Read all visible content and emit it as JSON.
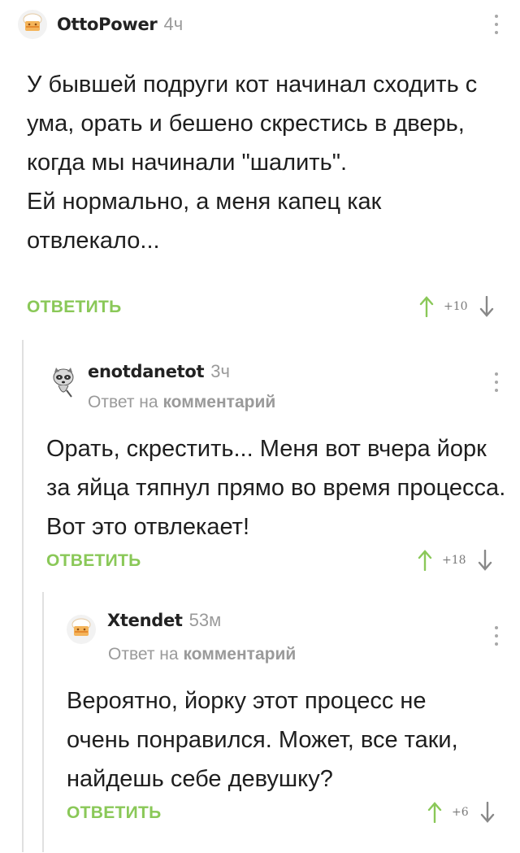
{
  "comments": [
    {
      "username": "OttoPower",
      "time": "4ч",
      "text": "У бывшей подруги кот начинал сходить с ума, орать и бешено скрестись в дверь, когда мы начинали \"шалить\".\nЕй нормально, а меня капец как отвлекало...",
      "reply_label": "ОТВЕТИТЬ",
      "rating": "+10"
    },
    {
      "username": "enotdanetot",
      "time": "3ч",
      "reply_to_prefix": "Ответ на",
      "reply_to_link": "комментарий",
      "text": "Орать, скрестить... Меня вот вчера йорк за яйца тяпнул прямо во время процесса. Вот это отвлекает!",
      "reply_label": "ОТВЕТИТЬ",
      "rating": "+18"
    },
    {
      "username": "Xtendet",
      "time": "53м",
      "reply_to_prefix": "Ответ на",
      "reply_to_link": "комментарий",
      "text": "Вероятно, йорку этот процесс не очень понравился. Может, все таки, найдешь себе девушку?",
      "reply_label": "ОТВЕТИТЬ",
      "rating": "+6"
    }
  ],
  "colors": {
    "accent": "#8ac858",
    "muted": "#9a9a9a",
    "thread": "#e0e0e0"
  },
  "icons": {
    "avatar_default": "chef-hat-avatar-icon",
    "avatar_raccoon": "raccoon-avatar-icon",
    "menu": "more-vertical-icon",
    "upvote": "arrow-up-icon",
    "downvote": "arrow-down-icon"
  }
}
